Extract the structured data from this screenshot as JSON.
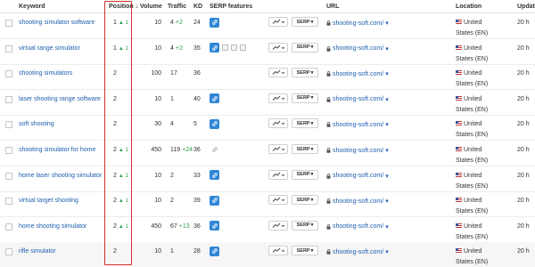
{
  "headers": {
    "keyword": "Keyword",
    "position": "Position ↓",
    "volume": "Volume",
    "traffic": "Traffic",
    "kd": "KD",
    "serp_features": "SERP features",
    "url": "URL",
    "location": "Location",
    "updated": "Updat"
  },
  "serp_button_label": "SERP",
  "colors": {
    "link": "#1f5fb0",
    "positive": "#2e9e4f",
    "highlight_box": "#d0312d",
    "serp_link_icon": "#2f86d6"
  },
  "rows": [
    {
      "keyword": "shooting simulator software",
      "position": "1",
      "position_change": "▲ 1",
      "volume": "10",
      "traffic": "4",
      "traffic_change": "+2",
      "kd": "24",
      "serp_icons": [
        "link-icon"
      ],
      "url": "shooting-soft.com/",
      "location": "United States (EN)",
      "updated": "20 h"
    },
    {
      "keyword": "virtual range simulator",
      "position": "1",
      "position_change": "▲ 1",
      "volume": "10",
      "traffic": "4",
      "traffic_change": "+2",
      "kd": "35",
      "serp_icons": [
        "link-icon",
        "image-icon",
        "news-icon",
        "snippet-icon"
      ],
      "url": "shooting-soft.com/",
      "location": "United States (EN)",
      "updated": "20 h"
    },
    {
      "keyword": "shooting simulators",
      "position": "2",
      "position_change": "",
      "volume": "100",
      "traffic": "17",
      "traffic_change": "",
      "kd": "36",
      "serp_icons": [],
      "url": "shooting-soft.com/",
      "location": "United States (EN)",
      "updated": "20 h"
    },
    {
      "keyword": "laser shooting range software",
      "position": "2",
      "position_change": "",
      "volume": "10",
      "traffic": "1",
      "traffic_change": "",
      "kd": "40",
      "serp_icons": [
        "link-icon"
      ],
      "url": "shooting-soft.com/",
      "location": "United States (EN)",
      "updated": "20 h"
    },
    {
      "keyword": "soft shooting",
      "position": "2",
      "position_change": "",
      "volume": "30",
      "traffic": "4",
      "traffic_change": "",
      "kd": "5",
      "serp_icons": [
        "link-icon"
      ],
      "url": "shooting-soft.com/",
      "location": "United States (EN)",
      "updated": "20 h"
    },
    {
      "keyword": "shooting simulator for home",
      "position": "2",
      "position_change": "▲ 1",
      "volume": "450",
      "traffic": "119",
      "traffic_change": "+24",
      "kd": "36",
      "serp_icons": [
        "link-icon-grey"
      ],
      "url": "shooting-soft.com/",
      "location": "United States (EN)",
      "updated": "20 h"
    },
    {
      "keyword": "home laser shooting simulator",
      "position": "2",
      "position_change": "▲ 1",
      "volume": "10",
      "traffic": "2",
      "traffic_change": "",
      "kd": "33",
      "serp_icons": [
        "link-icon"
      ],
      "url": "shooting-soft.com/",
      "location": "United States (EN)",
      "updated": "20 h"
    },
    {
      "keyword": "virtual target shooting",
      "position": "2",
      "position_change": "▲ 1",
      "volume": "10",
      "traffic": "2",
      "traffic_change": "",
      "kd": "39",
      "serp_icons": [
        "link-icon"
      ],
      "url": "shooting-soft.com/",
      "location": "United States (EN)",
      "updated": "20 h"
    },
    {
      "keyword": "home shooting simulator",
      "position": "2",
      "position_change": "▲ 1",
      "volume": "450",
      "traffic": "67",
      "traffic_change": "+13",
      "kd": "36",
      "serp_icons": [
        "link-icon"
      ],
      "url": "shooting-soft.com/",
      "location": "United States (EN)",
      "updated": "20 h"
    },
    {
      "keyword": "rifle simulator",
      "position": "2",
      "position_change": "",
      "volume": "10",
      "traffic": "1",
      "traffic_change": "",
      "kd": "28",
      "serp_icons": [
        "link-icon"
      ],
      "url": "shooting-soft.com/",
      "location": "United States (EN)",
      "updated": "20 h"
    }
  ]
}
